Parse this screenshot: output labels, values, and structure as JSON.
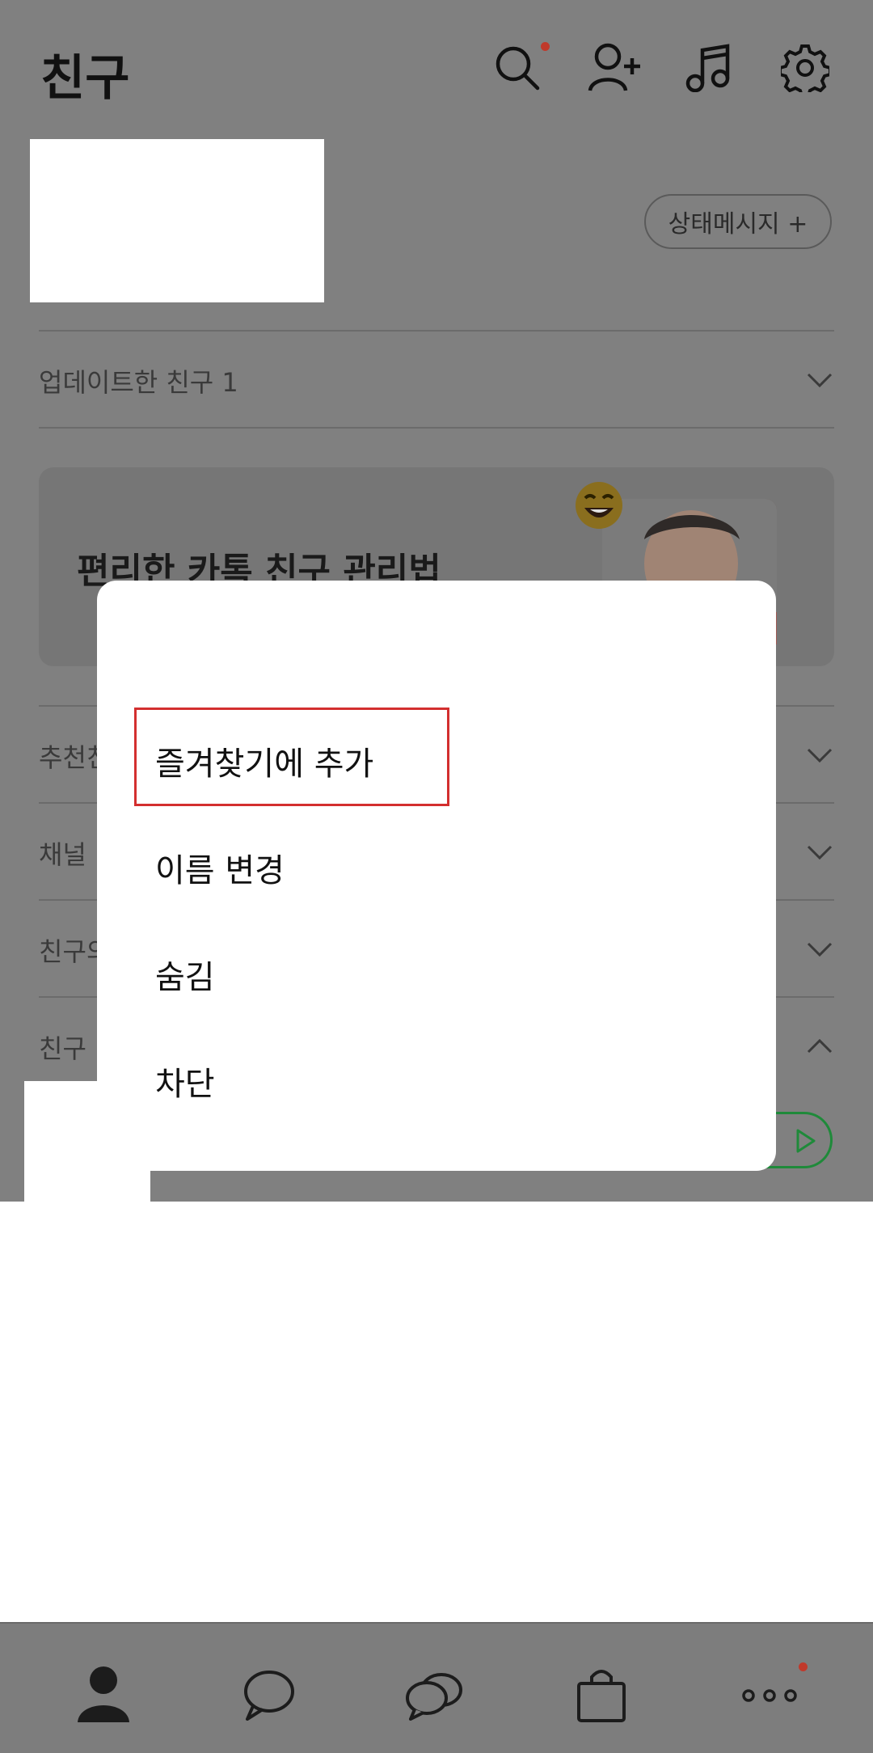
{
  "header": {
    "title": "친구"
  },
  "profile": {
    "status_button_label": "상태메시지 +"
  },
  "sections": {
    "updated_friends": "업데이트한 친구 1",
    "recommended_partial": "추천친",
    "channel": "채널",
    "friends_of_partial": "친구의",
    "friends": "친구"
  },
  "banner": {
    "text": "편리한 카톡 친구 관리법"
  },
  "context_menu": {
    "items": [
      "즐겨찾기에 추가",
      "이름 변경",
      "숨김",
      "차단"
    ]
  },
  "bottom_nav": {
    "icons": [
      "person-icon",
      "chat-bubble-icon",
      "open-chat-icon",
      "shopping-bag-icon",
      "more-icon"
    ]
  },
  "colors": {
    "badge": "#c0392b",
    "highlight": "#d32f2f",
    "green": "#1f8a3a"
  }
}
